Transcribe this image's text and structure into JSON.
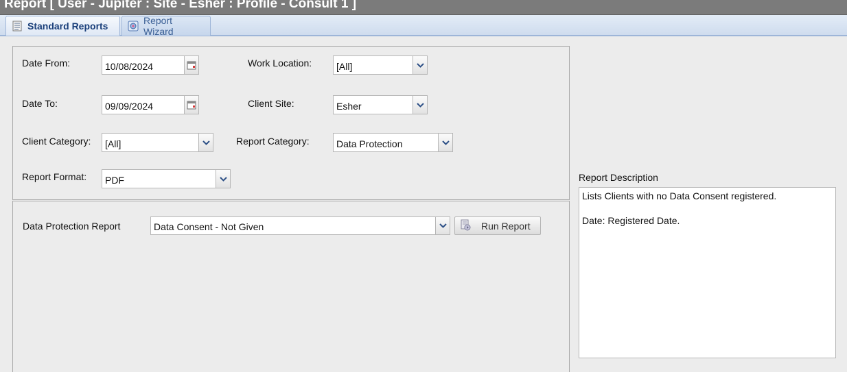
{
  "window": {
    "title": "Report [ User - Jupiter : Site - Esher : Profile - Consult 1 ]"
  },
  "tabs": [
    {
      "label": "Standard Reports",
      "icon": "report-list-icon",
      "active": true
    },
    {
      "label": "Report Wizard",
      "icon": "wizard-icon",
      "active": false
    }
  ],
  "filters": {
    "date_from": {
      "label": "Date From:",
      "value": "10/08/2024"
    },
    "date_to": {
      "label": "Date To:",
      "value": "09/09/2024"
    },
    "work_location": {
      "label": "Work Location:",
      "value": "[All]"
    },
    "client_site": {
      "label": "Client Site:",
      "value": "Esher"
    },
    "client_category": {
      "label": "Client Category:",
      "value": "[All]"
    },
    "report_category": {
      "label": "Report Category:",
      "value": "Data Protection"
    },
    "report_format": {
      "label": "Report Format:",
      "value": "PDF"
    }
  },
  "report": {
    "label": "Data Protection Report",
    "value": "Data Consent - Not Given",
    "run_label": "Run Report"
  },
  "description": {
    "label": "Report Description",
    "lines": [
      "Lists Clients with no Data Consent registered.",
      "Date: Registered Date."
    ]
  },
  "colors": {
    "title_bar": "#7b7b7b",
    "tab_active_text": "#1a3f7a",
    "dropdown_arrow": "#2c4f86"
  }
}
